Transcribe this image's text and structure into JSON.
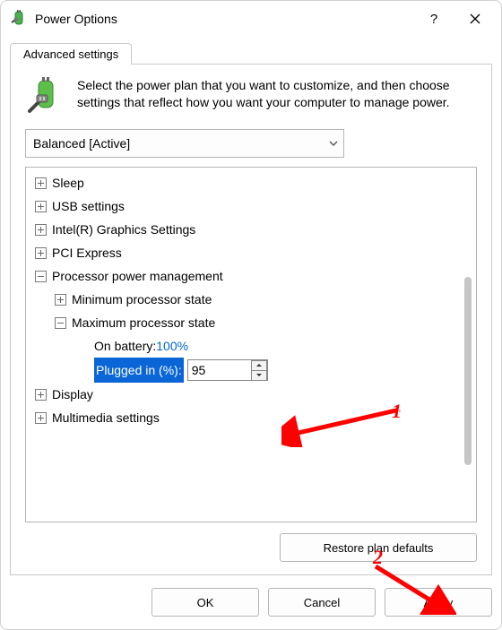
{
  "window": {
    "title": "Power Options"
  },
  "tab": {
    "label": "Advanced settings"
  },
  "intro": "Select the power plan that you want to customize, and then choose settings that reflect how you want your computer to manage power.",
  "plan": {
    "selected": "Balanced [Active]"
  },
  "tree": {
    "sleep": "Sleep",
    "usb": "USB settings",
    "intel_gfx": "Intel(R) Graphics Settings",
    "pci": "PCI Express",
    "ppm": "Processor power management",
    "min_state": "Minimum processor state",
    "max_state": "Maximum processor state",
    "on_battery_label": "On battery: ",
    "on_battery_value": "100%",
    "plugged_in_label": "Plugged in (%): ",
    "plugged_in_value": "95",
    "display": "Display",
    "multimedia": "Multimedia settings"
  },
  "buttons": {
    "restore": "Restore plan defaults",
    "ok": "OK",
    "cancel": "Cancel",
    "apply": "Apply"
  },
  "annotations": {
    "num1": "1",
    "num2": "2"
  }
}
